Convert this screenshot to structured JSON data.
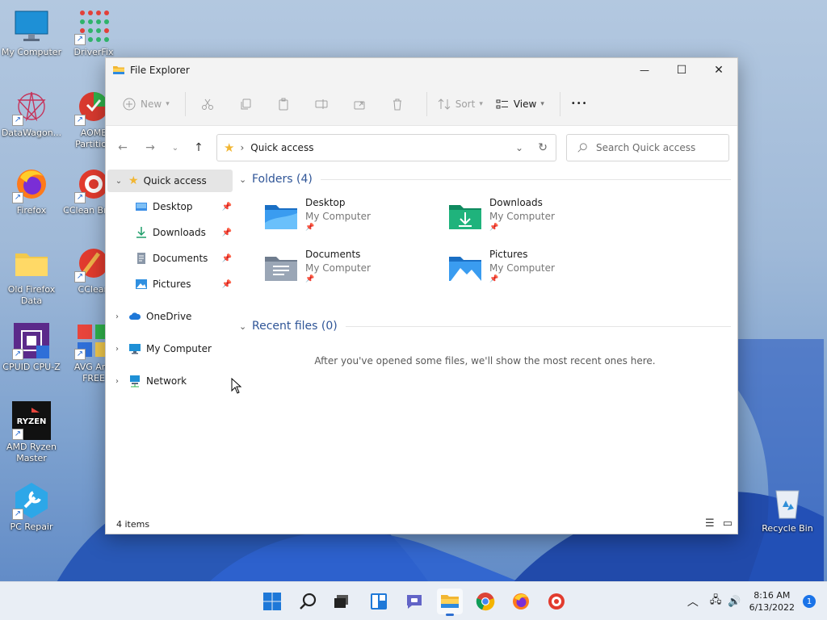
{
  "desktop": {
    "icons": [
      {
        "label": "My Computer"
      },
      {
        "label": "DriverFix"
      },
      {
        "label": "DataWagon..."
      },
      {
        "label": "AOME Partition"
      },
      {
        "label": "Firefox"
      },
      {
        "label": "CClean Brows"
      },
      {
        "label": "Old Firefox Data"
      },
      {
        "label": "CClean"
      },
      {
        "label": "CPUID CPU-Z"
      },
      {
        "label": "AVG Anti FREE"
      },
      {
        "label": "AMD Ryzen Master"
      },
      {
        "label": "PC Repair"
      },
      {
        "label": "Recycle Bin"
      }
    ]
  },
  "window": {
    "title": "File Explorer",
    "controls": {
      "minimize": "—",
      "maximize": "☐",
      "close": "✕"
    }
  },
  "commandbar": {
    "new_label": "New",
    "sort_label": "Sort",
    "view_label": "View",
    "more_label": "•••"
  },
  "address": {
    "breadcrumb_sep": "›",
    "location": "Quick access",
    "search_placeholder": "Search Quick access"
  },
  "sidebar": {
    "quick_access": "Quick access",
    "pinned": [
      {
        "label": "Desktop"
      },
      {
        "label": "Downloads"
      },
      {
        "label": "Documents"
      },
      {
        "label": "Pictures"
      }
    ],
    "onedrive": "OneDrive",
    "my_computer": "My Computer",
    "network": "Network"
  },
  "content": {
    "folders_header": "Folders (4)",
    "folders": [
      {
        "name": "Desktop",
        "location": "My Computer"
      },
      {
        "name": "Downloads",
        "location": "My Computer"
      },
      {
        "name": "Documents",
        "location": "My Computer"
      },
      {
        "name": "Pictures",
        "location": "My Computer"
      }
    ],
    "recent_header": "Recent files (0)",
    "recent_empty": "After you've opened some files, we'll show the most recent ones here."
  },
  "status": {
    "items_count": "4 items"
  },
  "taskbar": {
    "clock_time": "8:16 AM",
    "clock_date": "6/13/2022",
    "notification_count": "1"
  },
  "colors": {
    "accent": "#2d6fd1",
    "section_header": "#2f5597",
    "folder_blue": "#3a8ee6"
  }
}
